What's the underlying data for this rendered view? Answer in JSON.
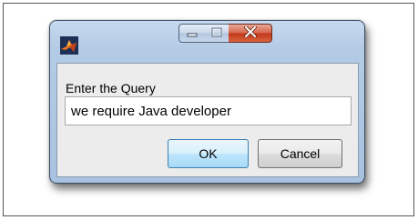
{
  "dialog": {
    "title": "",
    "app_icon": "matlab-logo-icon",
    "titlebar_buttons": {
      "minimize_icon": "minimize-icon",
      "maximize_icon": "maximize-icon",
      "close_icon": "close-icon",
      "close_color": "#c2381a"
    },
    "prompt_label": "Enter the Query",
    "query_value": "we require Java developer",
    "ok_label": "OK",
    "cancel_label": "Cancel",
    "accent_color": "#3c7fb1"
  }
}
